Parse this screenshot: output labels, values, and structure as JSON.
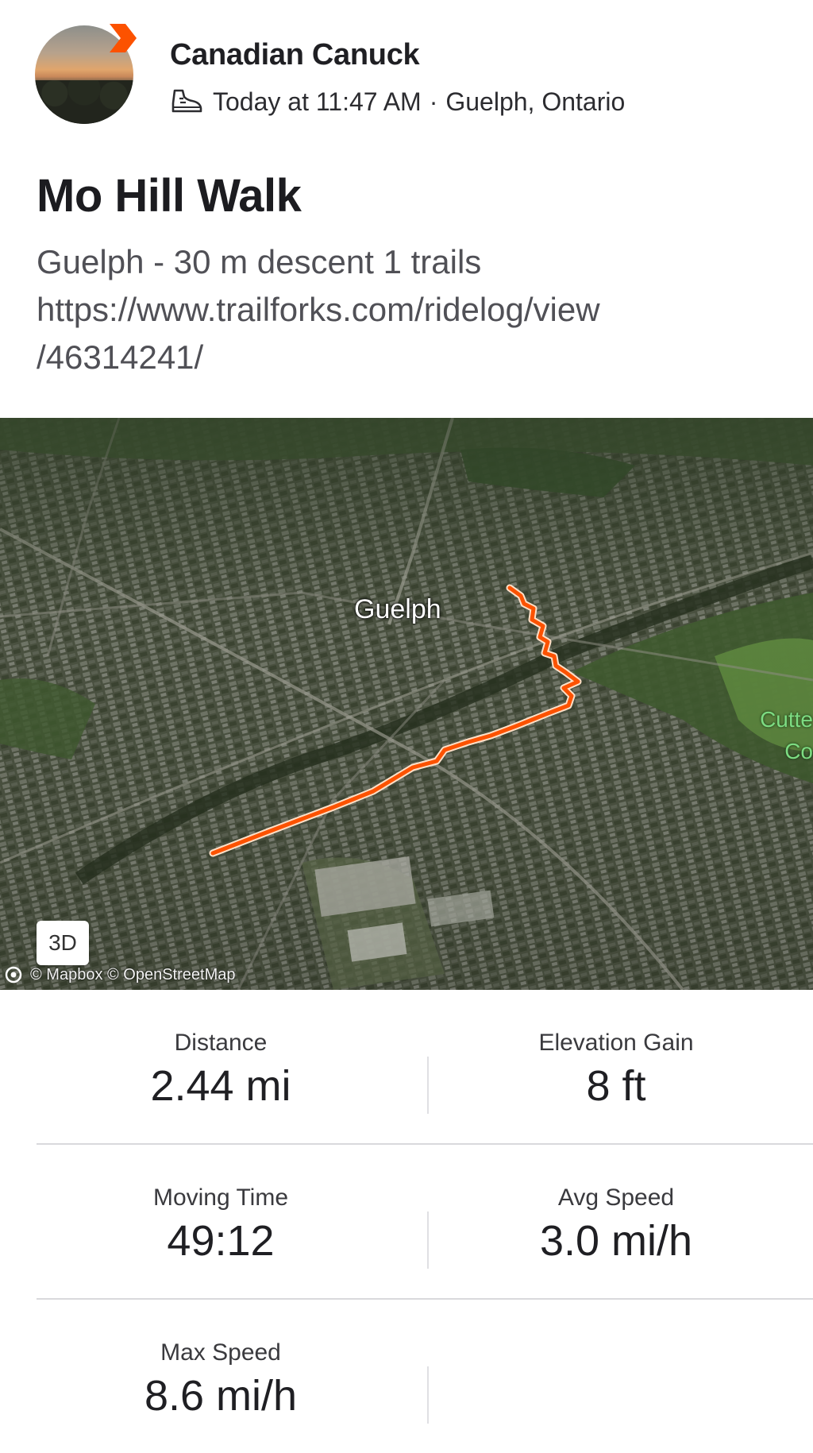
{
  "header": {
    "username": "Canadian Canuck",
    "timestamp": "Today at 11:47 AM",
    "separator": "·",
    "location": "Guelph, Ontario",
    "activity_icon": "shoe-icon"
  },
  "activity": {
    "title": "Mo Hill Walk",
    "description_line1": "Guelph - 30 m descent 1 trails",
    "description_line2": "https://www.trailforks.com/ridelog/view",
    "description_line3": "/46314241/"
  },
  "map": {
    "label_city": "Guelph",
    "label_park_line1": "Cutte",
    "label_park_line2": "Co",
    "button_3d": "3D",
    "attribution": "© Mapbox © OpenStreetMap",
    "route_color": "#fc5200"
  },
  "stats": {
    "distance": {
      "label": "Distance",
      "value": "2.44 mi"
    },
    "elevation_gain": {
      "label": "Elevation Gain",
      "value": "8 ft"
    },
    "moving_time": {
      "label": "Moving Time",
      "value": "49:12"
    },
    "avg_speed": {
      "label": "Avg Speed",
      "value": "3.0 mi/h"
    },
    "max_speed": {
      "label": "Max Speed",
      "value": "8.6 mi/h"
    }
  },
  "colors": {
    "brand": "#fc5200",
    "text_primary": "#1f1f23",
    "text_secondary": "#505056"
  }
}
